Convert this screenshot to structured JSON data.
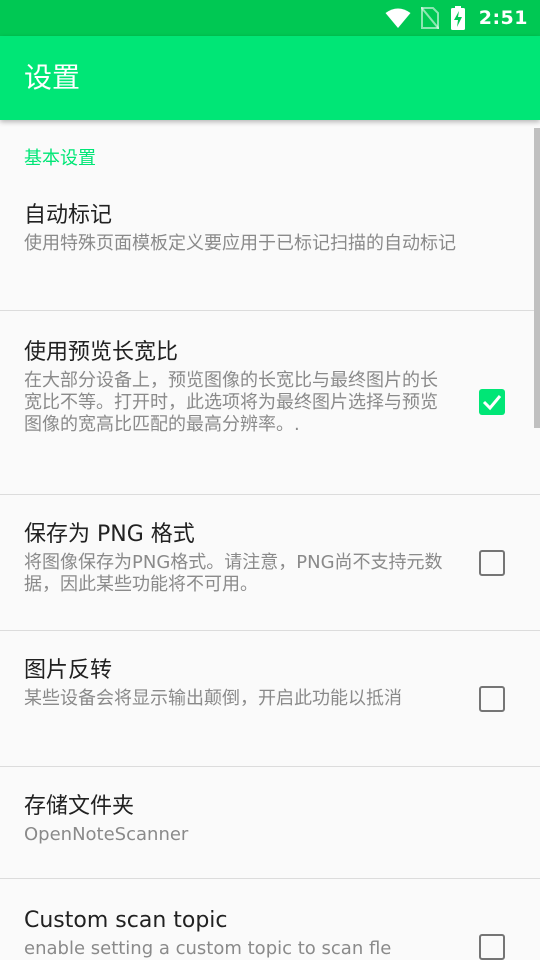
{
  "status_bar": {
    "time": "2:51",
    "icons": [
      "wifi-icon",
      "no-sim-icon",
      "battery-charging-icon"
    ]
  },
  "app_bar": {
    "title": "设置"
  },
  "category": {
    "label": "基本设置"
  },
  "preferences": [
    {
      "title": "自动标记",
      "summary": "使用特殊页面模板定义要应用于已标记扫描的自动标记",
      "has_checkbox": false
    },
    {
      "title": "使用预览长宽比",
      "summary": "在大部分设备上，预览图像的长宽比与最终图片的长宽比不等。打开时，此选项将为最终图片选择与预览图像的宽高比匹配的最高分辨率。.",
      "has_checkbox": true,
      "checked": true
    },
    {
      "title": "保存为 PNG 格式",
      "summary": "将图像保存为PNG格式。请注意，PNG尚不支持元数据，因此某些功能将不可用。",
      "has_checkbox": true,
      "checked": false
    },
    {
      "title": "图片反转",
      "summary": "某些设备会将显示输出颠倒，开启此功能以抵消",
      "has_checkbox": true,
      "checked": false
    },
    {
      "title": "存储文件夹",
      "summary": "OpenNoteScanner",
      "has_checkbox": false
    },
    {
      "title": "Custom scan topic",
      "summary": "enable setting a custom topic to scan fle",
      "has_checkbox": true,
      "checked": false
    }
  ],
  "colors": {
    "status_bar": "#00c853",
    "app_bar": "#00e676",
    "accent": "#00e676"
  }
}
